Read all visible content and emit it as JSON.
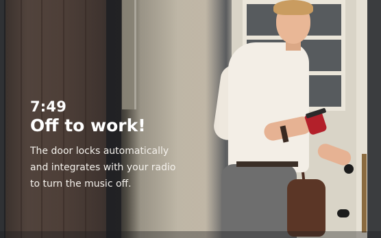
{
  "overlay": {
    "time": "7:49",
    "headline": "Off to work!",
    "description_lines": [
      "The door locks automatically",
      "and integrates with your radio",
      "to turn the music off."
    ]
  },
  "colors": {
    "text": "#ffffff",
    "cup": "#b3202a",
    "door": "#d9d4c7"
  }
}
